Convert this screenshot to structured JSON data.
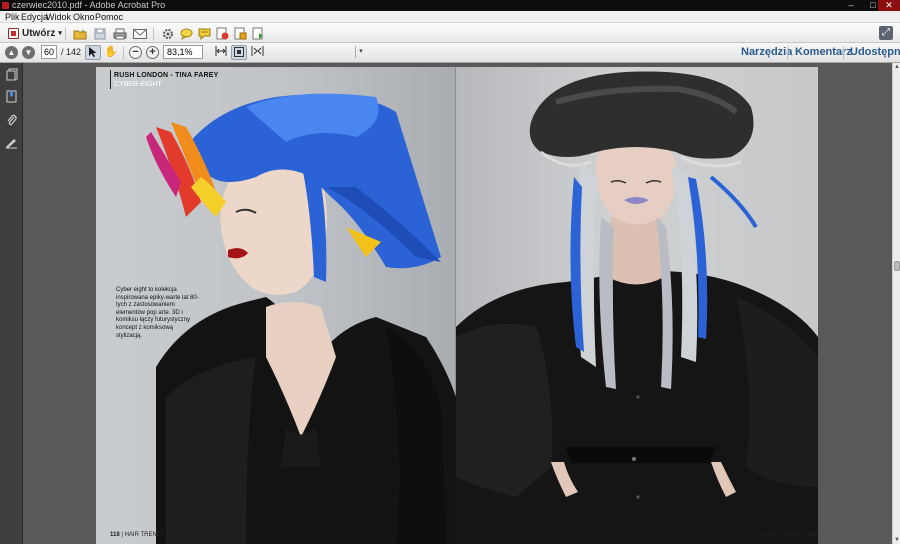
{
  "window": {
    "title": "czerwiec2010.pdf - Adobe Acrobat Pro",
    "controls": {
      "minimize": "–",
      "maximize": "□",
      "close": "✕"
    }
  },
  "menu": {
    "items": [
      "Plik",
      "Edycja",
      "Widok",
      "Okno",
      "Pomoc"
    ]
  },
  "toolbar1": {
    "create_label": "Utwórz",
    "create_arrow": "▾",
    "icons": [
      "open-folder-icon",
      "save-icon",
      "print-icon",
      "email-icon",
      "settings-icon",
      "comment-icon",
      "sticky-note-icon",
      "stamp-icon",
      "share-file-icon",
      "attach-file-icon"
    ],
    "expand_icon": "expand-icon"
  },
  "toolbar2": {
    "current_page": "60",
    "total_pages": "/ 142",
    "zoom": "83,1%",
    "zoom_arrow": "▾",
    "tabs": [
      "Narzędzia",
      "Komentarz",
      "Udostępnij"
    ]
  },
  "left_panel": {
    "icons": [
      "pages-icon",
      "bookmarks-icon",
      "attachments-icon",
      "signatures-icon"
    ]
  },
  "document": {
    "left_page": {
      "credit_title": "RUSH LONDON - TINA FAREY",
      "credit_subtitle": "CYBER-EIGHT",
      "caption": "Cyber eight to kolekcja inspirowana epiky-warte lat 80-tych z zastosowaniem elementów pop arte. 3D i komiksu łączy futurystyczny koncept z komiksową stylizacją.",
      "folio_number": "118",
      "folio_text": "HAIR TRENDY"
    },
    "right_page": {
      "folio_text": "HAIR TRENDY",
      "folio_number": "119"
    }
  },
  "colors": {
    "accent_blue": "#2a5a8e",
    "hair_blue": "#2b63d6",
    "lip_red": "#a51218",
    "lip_lavender": "#8f86c8"
  }
}
